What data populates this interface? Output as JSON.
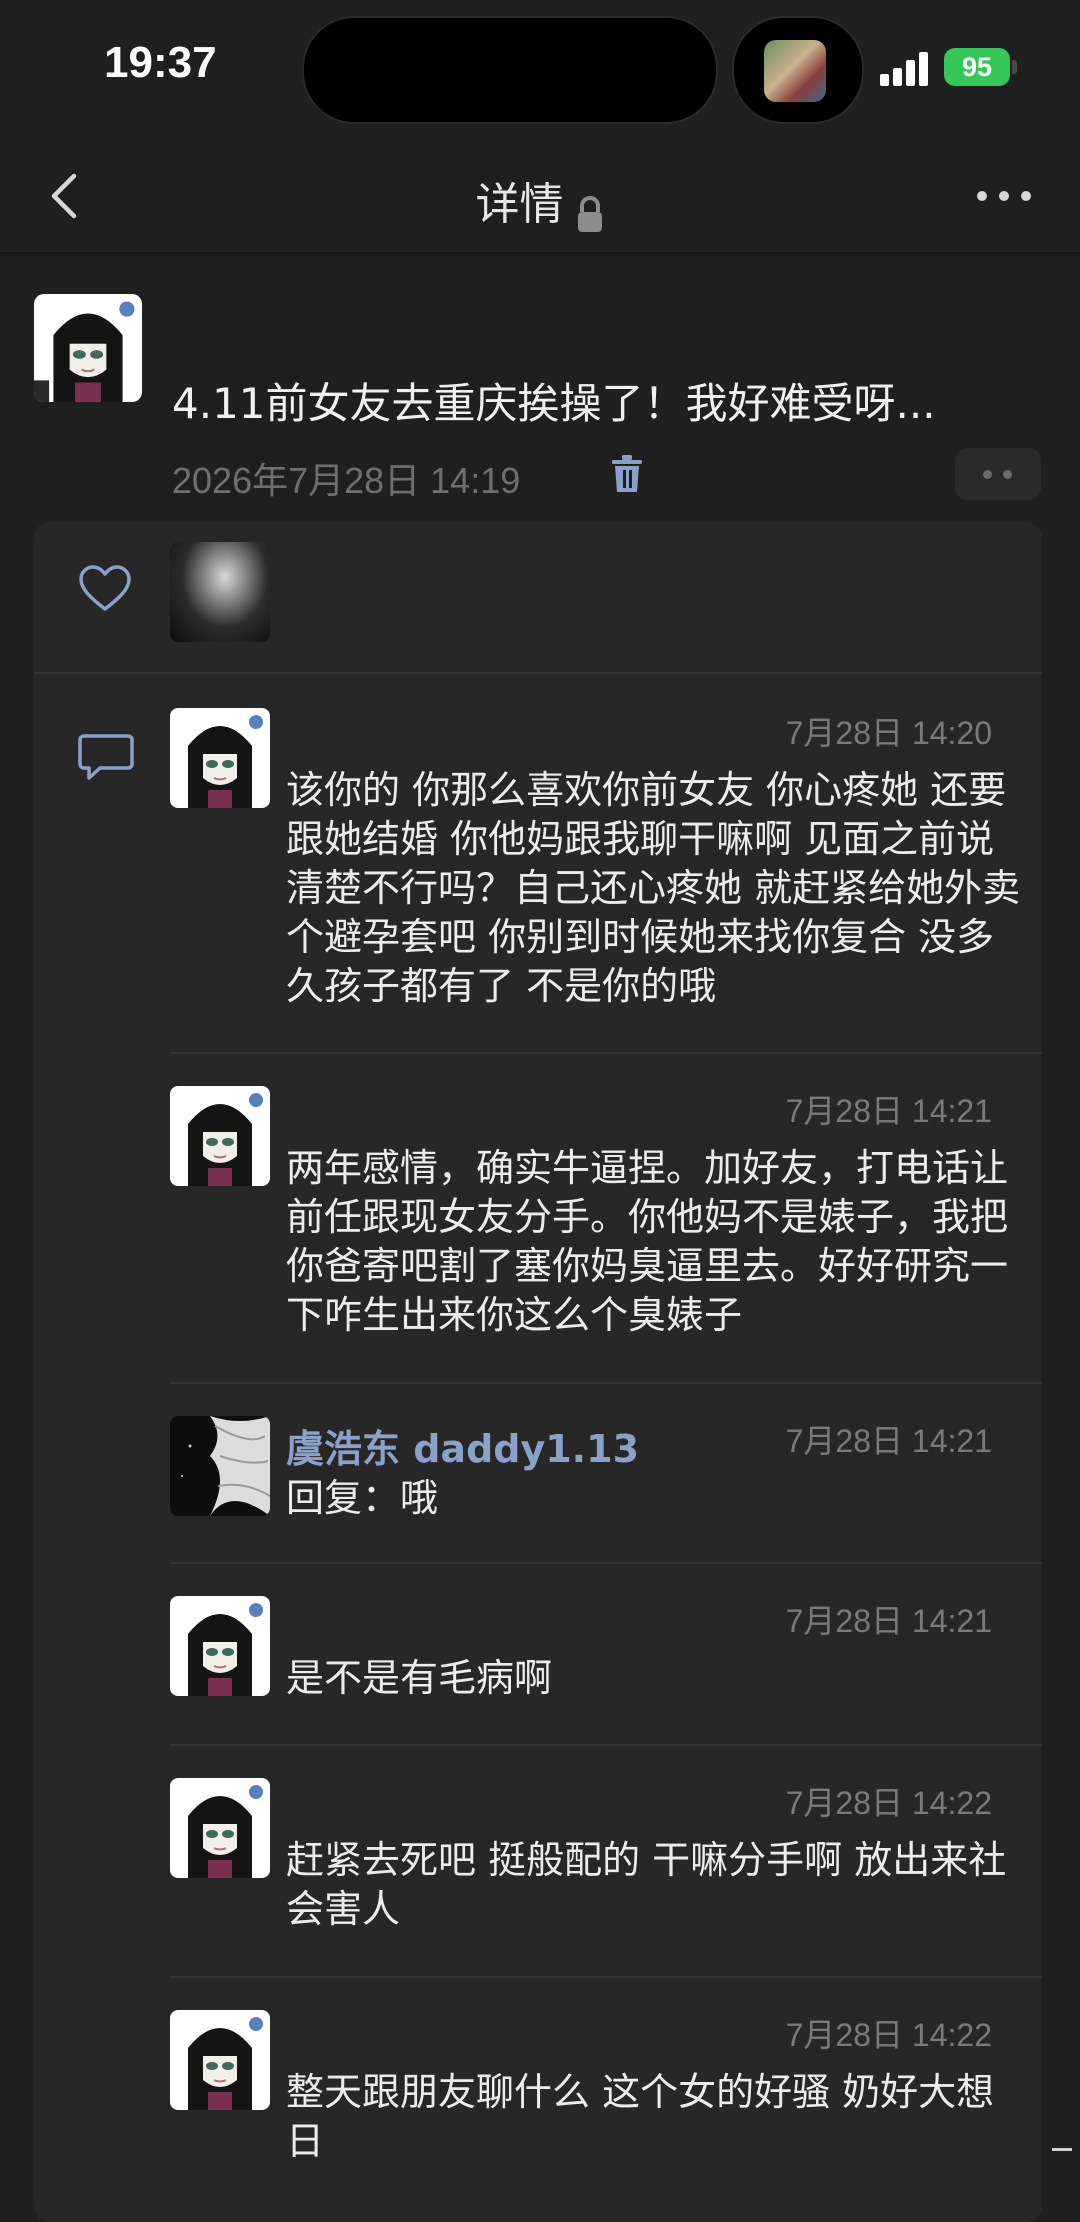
{
  "status_bar": {
    "time": "19:37",
    "battery": "95"
  },
  "nav": {
    "title": "详情"
  },
  "post": {
    "title": "4.11前女友去重庆挨操了！我好难受呀...",
    "timestamp": "2026年7月28日 14:19"
  },
  "comments": [
    {
      "name": "",
      "time": "7月28日 14:20",
      "text": "该你的 你那么喜欢你前女友 你心疼她 还要跟她结婚 你他妈跟我聊干嘛啊 见面之前说清楚不行吗？自己还心疼她 就赶紧给她外卖个避孕套吧 你别到时候她来找你复合 没多久孩子都有了 不是你的哦"
    },
    {
      "name": "",
      "time": "7月28日 14:21",
      "text": "两年感情，确实牛逼捏。加好友，打电话让前任跟现女友分手。你他妈不是婊子，我把你爸寄吧割了塞你妈臭逼里去。好好研究一下咋生出来你这么个臭婊子"
    },
    {
      "name": "虞浩东 daddy1.13",
      "time": "7月28日 14:21",
      "text": "回复：哦"
    },
    {
      "name": "",
      "time": "7月28日 14:21",
      "text": "是不是有毛病啊"
    },
    {
      "name": "",
      "time": "7月28日 14:22",
      "text": "赶紧去死吧 挺般配的 干嘛分手啊 放出来社会害人"
    },
    {
      "name": "",
      "time": "7月28日 14:22",
      "text": "整天跟朋友聊什么 这个女的好骚 奶好大想日"
    }
  ],
  "icons": {
    "back": "chevron-left-icon",
    "more": "more-horizontal-icon",
    "lock": "lock-icon",
    "trash": "trash-icon",
    "like": "heart-icon",
    "comment": "comment-icon"
  },
  "colors": {
    "background": "#1f1f1f",
    "panel": "#272727",
    "link_name": "#8aa1c8",
    "trash": "#8aa1c8",
    "battery": "#35c759"
  }
}
